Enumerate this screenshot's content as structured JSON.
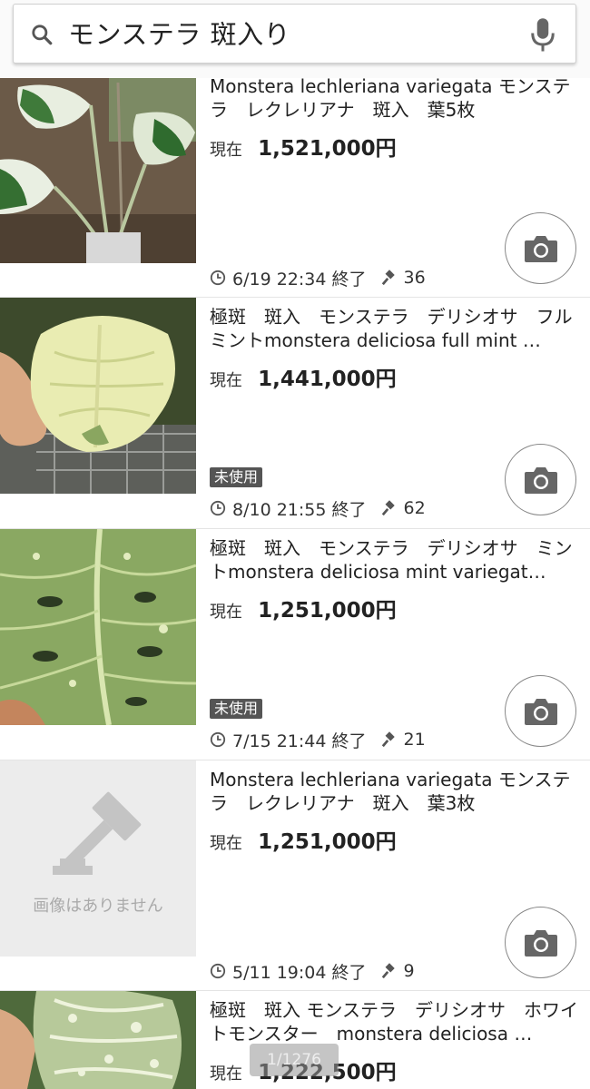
{
  "search": {
    "query": "モンステラ 斑入り",
    "icon": "search-icon",
    "mic_icon": "mic-icon"
  },
  "listings": [
    {
      "title": "Monstera lechleriana variegata モンステラ　レクレリアナ　斑入　葉5枚",
      "price_label": "現在",
      "price": "1,521,000円",
      "badge": "",
      "end_time": "6/19 22:34 終了",
      "bids": "36",
      "thumbnail": "variegated-monstera-plant-photo"
    },
    {
      "title": "極斑　斑入　モンステラ　デリシオサ　フルミントmonstera deliciosa full mint …",
      "price_label": "現在",
      "price": "1,441,000円",
      "badge": "未使用",
      "end_time": "8/10 21:55 終了",
      "bids": "62",
      "thumbnail": "hand-holding-mint-leaf-photo"
    },
    {
      "title": "極斑　斑入　モンステラ　デリシオサ　ミントmonstera deliciosa mint variegat…",
      "price_label": "現在",
      "price": "1,251,000円",
      "badge": "未使用",
      "end_time": "7/15 21:44 終了",
      "bids": "21",
      "thumbnail": "speckled-leaf-photo"
    },
    {
      "title": "Monstera lechleriana variegata モンステラ　レクレリアナ　斑入　葉3枚",
      "price_label": "現在",
      "price": "1,251,000円",
      "badge": "",
      "end_time": "5/11 19:04 終了",
      "bids": "9",
      "thumbnail": "no-image-placeholder",
      "no_image_text": "画像はありません"
    },
    {
      "title": "極斑　斑入 モンステラ　デリシオサ　ホワイトモンスター　monstera deliciosa …",
      "price_label": "現在",
      "price": "1,222,500円",
      "badge": "",
      "thumbnail": "white-monster-leaf-photo"
    }
  ],
  "page_indicator": "1/1276",
  "colors": {
    "badge_bg": "#555555",
    "divider": "#e4e4e4",
    "placeholder_bg": "#ececec"
  }
}
